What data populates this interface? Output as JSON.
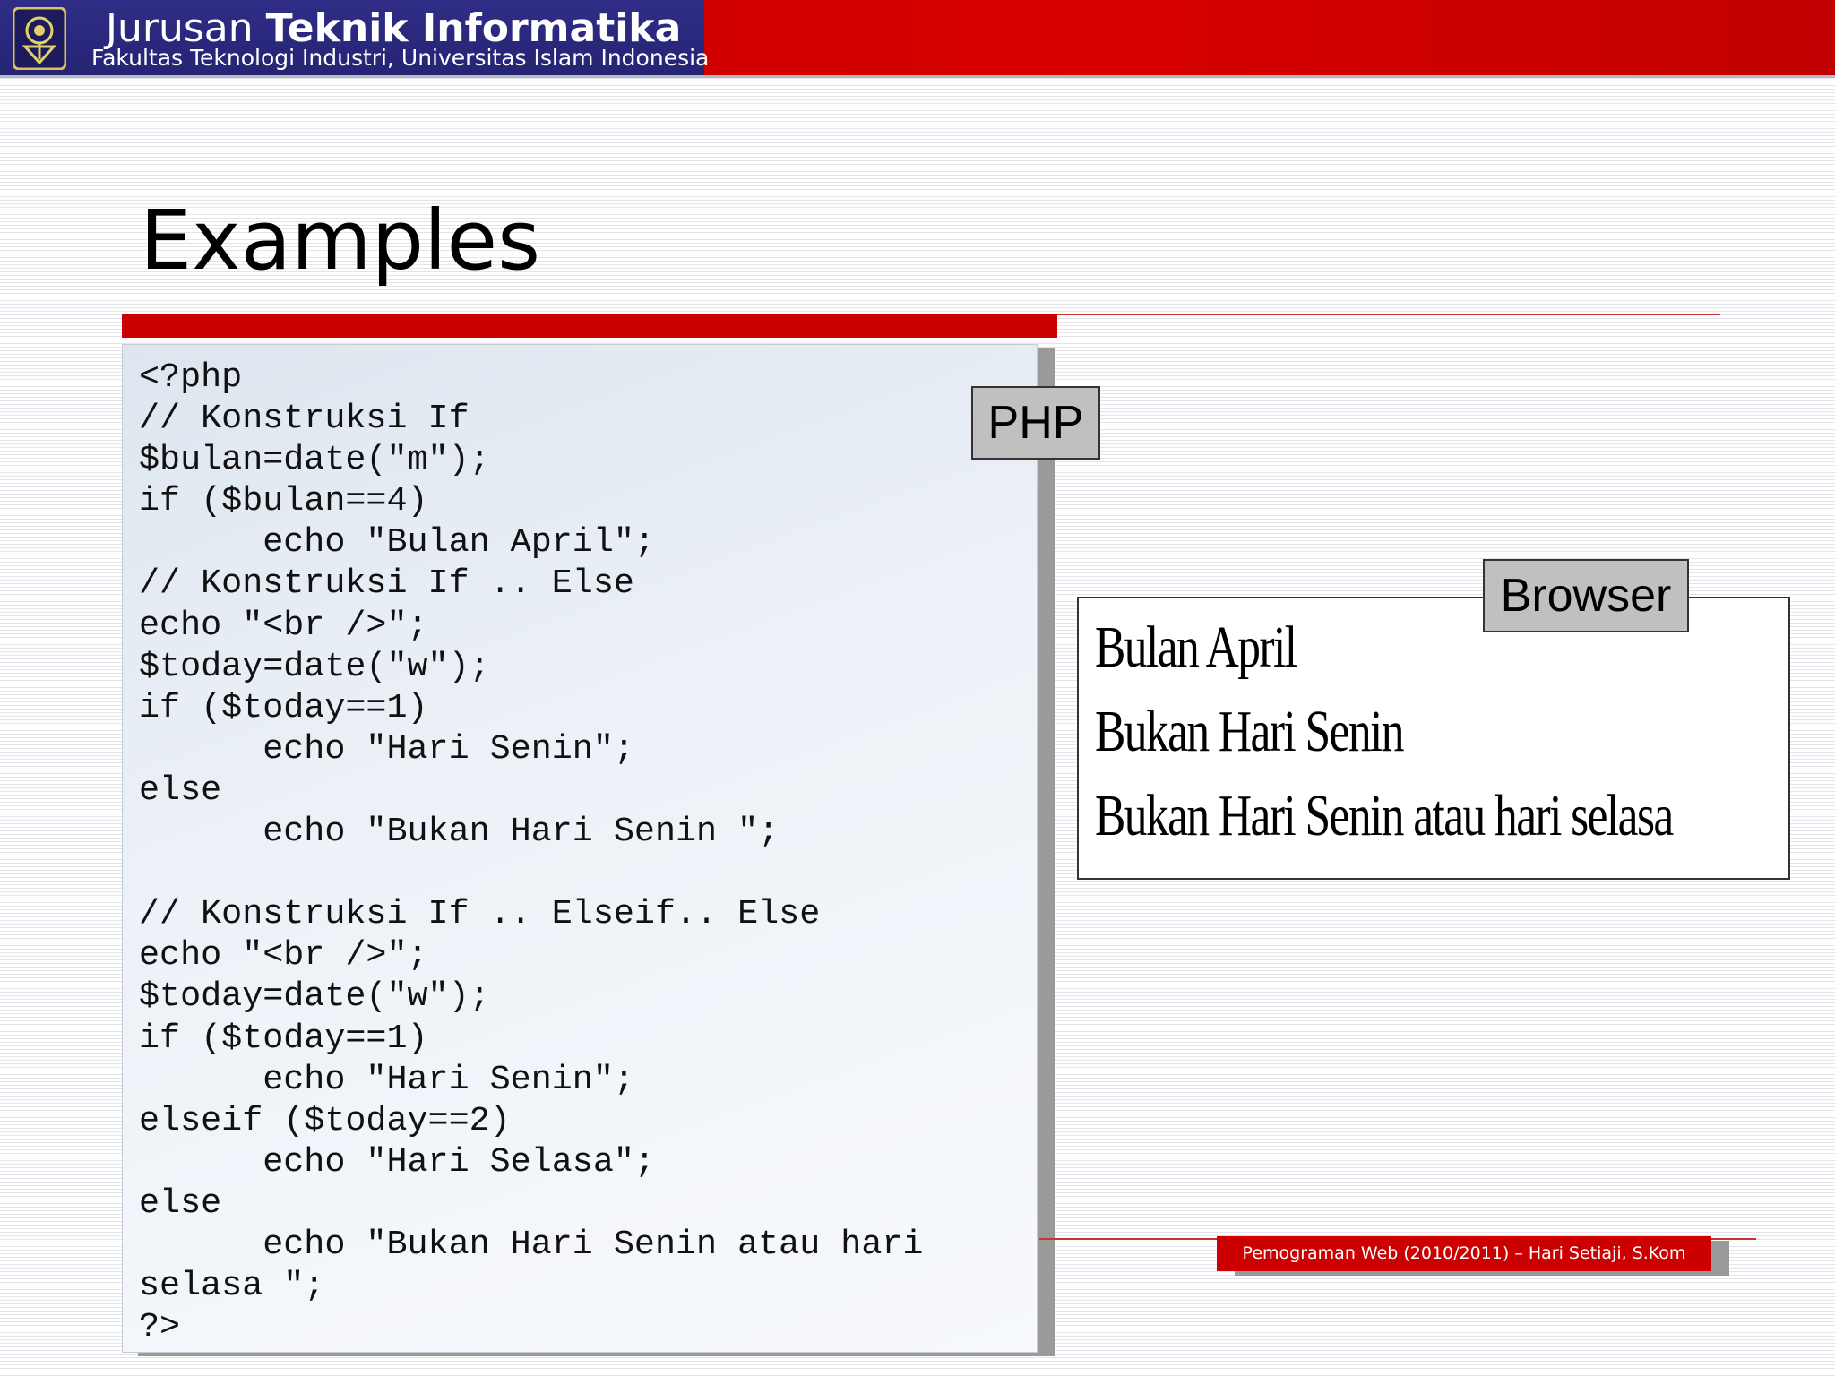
{
  "header": {
    "dept_prefix": "Jurusan",
    "dept_name": "Teknik Informatika",
    "faculty": "Fakultas Teknologi Industri, Universitas Islam Indonesia",
    "logo_icon": "university-crest-icon"
  },
  "slide": {
    "title": "Examples"
  },
  "code": {
    "text": "<?php\n// Konstruksi If\n$bulan=date(\"m\");\nif ($bulan==4)\n      echo \"Bulan April\";\n// Konstruksi If .. Else\necho \"<br />\";\n$today=date(\"w\");\nif ($today==1)\n      echo \"Hari Senin\";\nelse\n      echo \"Bukan Hari Senin \";\n\n// Konstruksi If .. Elseif.. Else\necho \"<br />\";\n$today=date(\"w\");\nif ($today==1)\n      echo \"Hari Senin\";\nelseif ($today==2)\n      echo \"Hari Selasa\";\nelse\n      echo \"Bukan Hari Senin atau hari\nselasa \";\n?>"
  },
  "labels": {
    "php": "PHP",
    "browser": "Browser"
  },
  "browser_output": [
    "Bulan April",
    "Bukan Hari Senin",
    "Bukan Hari Senin atau hari selasa"
  ],
  "footer": {
    "text": "Pemograman Web (2010/2011) – Hari Setiaji, S.Kom"
  },
  "colors": {
    "header_red": "#cc0000",
    "header_navy": "#2b2a7f",
    "accent_red": "#cc0000",
    "label_gray": "#c0c0c0"
  }
}
